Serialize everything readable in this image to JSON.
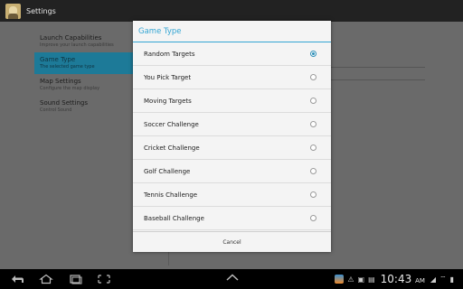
{
  "actionbar": {
    "title": "Settings"
  },
  "settings": {
    "items": [
      {
        "title": "Launch Capabilities",
        "subtitle": "Improve your launch capabilities",
        "active": false
      },
      {
        "title": "Game Type",
        "subtitle": "The selected game type",
        "active": true
      },
      {
        "title": "Map Settings",
        "subtitle": "Configure the map display",
        "active": false
      },
      {
        "title": "Sound Settings",
        "subtitle": "Control Sound",
        "active": false
      }
    ]
  },
  "dialog": {
    "title": "Game Type",
    "options": [
      {
        "label": "Random Targets",
        "selected": true
      },
      {
        "label": "You Pick Target",
        "selected": false
      },
      {
        "label": "Moving Targets",
        "selected": false
      },
      {
        "label": "Soccer Challenge",
        "selected": false
      },
      {
        "label": "Cricket Challenge",
        "selected": false
      },
      {
        "label": "Golf Challenge",
        "selected": false
      },
      {
        "label": "Tennis Challenge",
        "selected": false
      },
      {
        "label": "Baseball Challenge",
        "selected": false
      }
    ],
    "cancel_label": "Cancel"
  },
  "systembar": {
    "time": "10:43",
    "ampm": "AM",
    "nav_icons": [
      "back-icon",
      "home-icon",
      "recents-icon",
      "screenshot-icon",
      "chevron-up-icon"
    ],
    "tray_icons": [
      "app-notification-icon",
      "warning-icon",
      "gallery-icon",
      "sd-card-icon",
      "signal-icon",
      "wifi-icon",
      "battery-icon"
    ]
  },
  "colors": {
    "accent": "#33a5d3",
    "selected_pref": "#1d7a98"
  }
}
